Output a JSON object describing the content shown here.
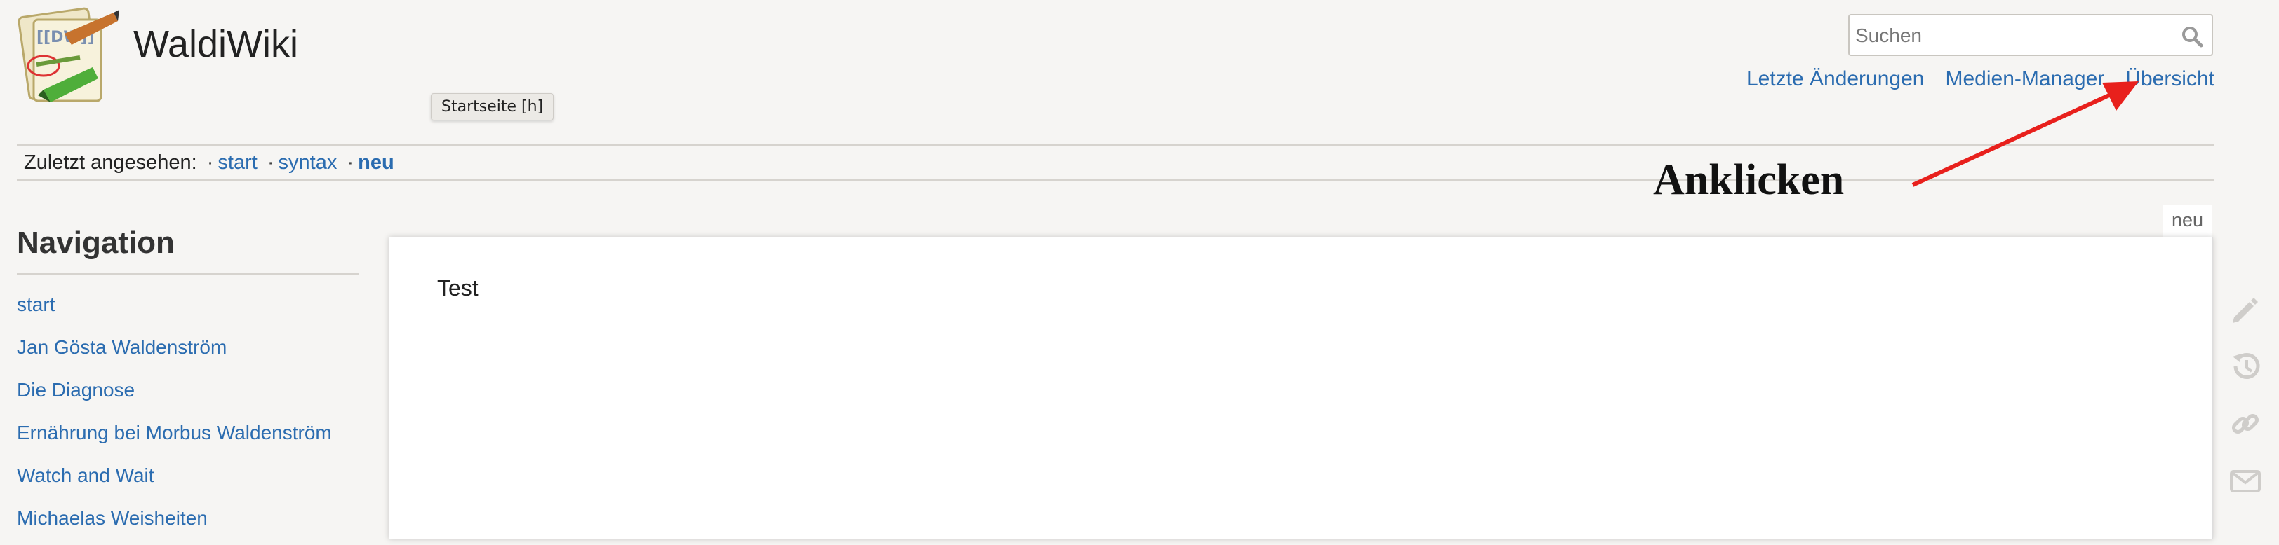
{
  "header": {
    "site_title": "WaldiWiki",
    "logo_text": "[[DW]]",
    "tooltip": "Startseite [h]"
  },
  "search": {
    "placeholder": "Suchen"
  },
  "usertools": [
    {
      "label": "Letzte Änderungen"
    },
    {
      "label": "Medien-Manager"
    },
    {
      "label": "Übersicht"
    }
  ],
  "breadcrumbs": {
    "label": "Zuletzt angesehen:",
    "sep": "·",
    "items": [
      "start",
      "syntax",
      "neu"
    ]
  },
  "annotation": {
    "text": "Anklicken",
    "arrow_color": "#e8201c"
  },
  "navigation": {
    "title": "Navigation",
    "items": [
      "start",
      "Jan Gösta Waldenström",
      "Die Diagnose",
      "Ernährung bei Morbus Waldenström",
      "Watch and Wait",
      "Michaelas Weisheiten"
    ]
  },
  "page": {
    "id": "neu",
    "content": "Test"
  },
  "pagetools": [
    {
      "icon": "pencil-icon"
    },
    {
      "icon": "history-icon"
    },
    {
      "icon": "link-icon"
    },
    {
      "icon": "mail-icon"
    }
  ],
  "colors": {
    "link": "#2b6cb0",
    "background": "#f6f5f3"
  }
}
